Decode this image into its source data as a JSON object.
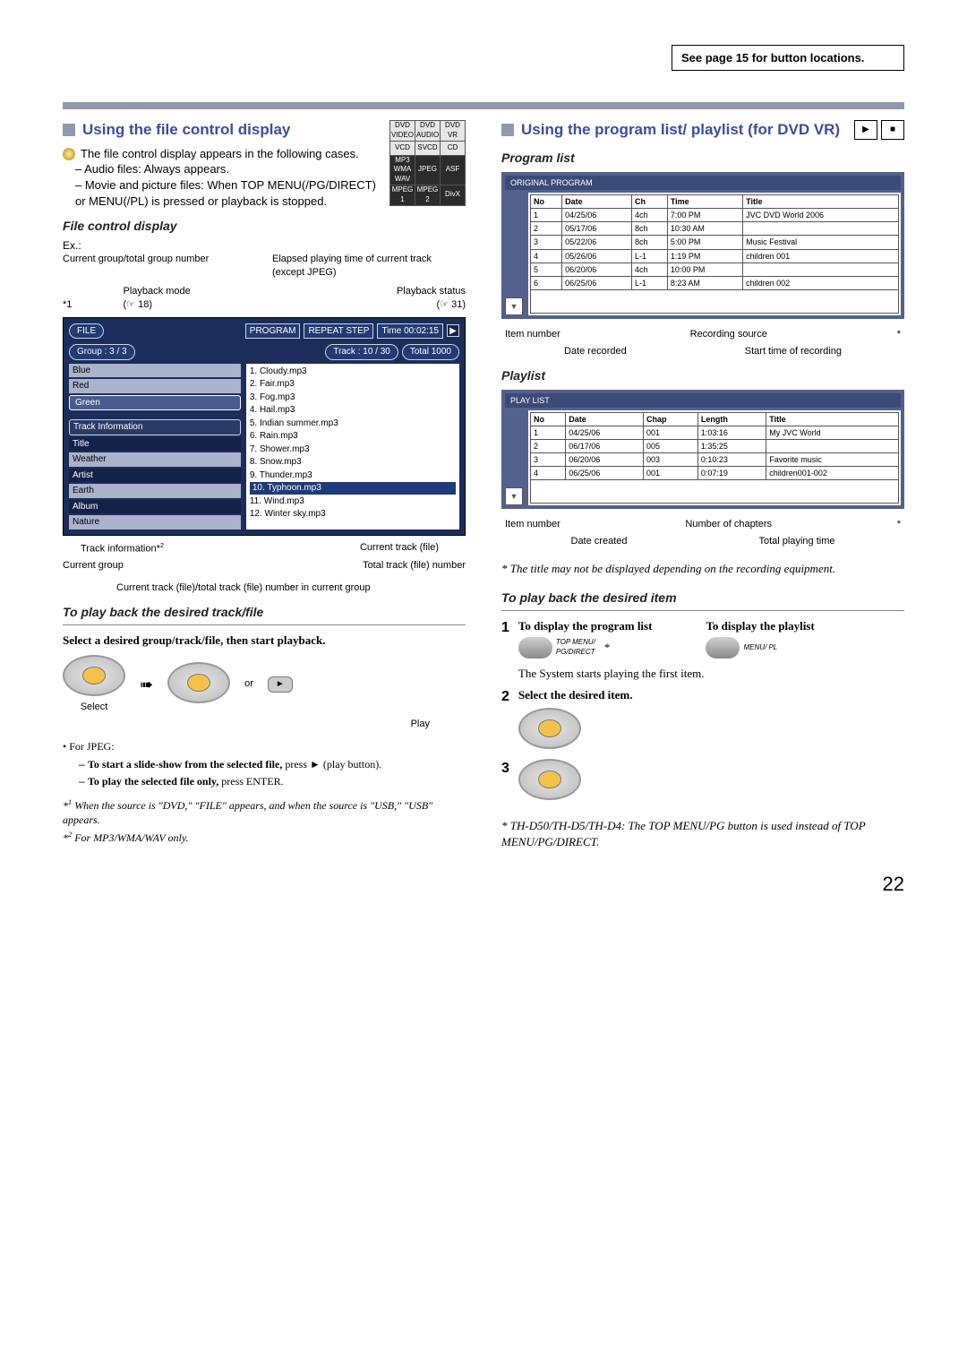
{
  "top_note": "See page 15 for button locations.",
  "left": {
    "heading": "Using the file control display",
    "intro": "The file control display appears in the following cases.",
    "bullets": [
      "Audio files: Always appears.",
      "Movie and picture files: When TOP MENU(/PG/DIRECT) or MENU(/PL) is pressed or playback is stopped."
    ],
    "format_cells": [
      [
        "DVD VIDEO",
        "DVD AUDIO",
        "DVD VR"
      ],
      [
        "VCD",
        "SVCD",
        "CD"
      ],
      [
        "MP3 WMA WAV",
        "JPEG",
        "ASF"
      ],
      [
        "MPEG 1",
        "MPEG 2",
        "DivX"
      ]
    ],
    "file_control_heading": "File control display",
    "ex": "Ex.:",
    "annot_top_left": "Current group/total group number",
    "annot_top_right": "Elapsed playing time of current track (except JPEG)",
    "annot_mid_left": "Playback mode",
    "annot_mid_left_ref": "(☞ 18)",
    "annot_mid_right": "Playback status",
    "annot_mid_right_ref": "(☞ 31)",
    "star1": "*1",
    "fd": {
      "file_label": "FILE",
      "program": "PROGRAM",
      "repeat": "REPEAT STEP",
      "time": "Time 00:02:15",
      "group": "Group :   3 / 3",
      "track": "Track : 10 / 30",
      "total": "Total 1000",
      "left_items": [
        "Blue",
        "Red",
        "Green"
      ],
      "track_info_hdr": "Track  Information",
      "track_info": [
        "Title",
        "Weather",
        "Artist",
        "Earth",
        "Album",
        "Nature"
      ],
      "right_items": [
        "1. Cloudy.mp3",
        "2. Fair.mp3",
        "3. Fog.mp3",
        "4. Hail.mp3",
        "5. Indian summer.mp3",
        "6. Rain.mp3",
        "7. Shower.mp3",
        "8. Snow.mp3",
        "9. Thunder.mp3",
        "10. Typhoon.mp3",
        "11. Wind.mp3",
        "12. Winter sky.mp3"
      ],
      "sel_index": 9
    },
    "annot_track_info": "Track information*2",
    "annot_current_track": "Current track (file)",
    "annot_current_group": "Current group",
    "annot_total_track": "Total track (file) number",
    "annot_ratio": "Current track (file)/total track (file) number in current group",
    "play_heading": "To play back the desired track/file",
    "play_instruction": "Select a desired group/track/file, then start playback.",
    "select_label": "Select",
    "or": "or",
    "play_label": "Play",
    "jpeg_hdr": "For JPEG:",
    "jpeg_a_bold": "To start a slide-show from the selected file,",
    "jpeg_a_rest": " press ► (play button).",
    "jpeg_b_bold": "To play the selected file only,",
    "jpeg_b_rest": " press ENTER.",
    "fn1": "*1 When the source is \"DVD,\" \"FILE\" appears, and when the source is \"USB,\" \"USB\" appears.",
    "fn2": "*2 For MP3/WMA/WAV only."
  },
  "right": {
    "heading": "Using the program list/ playlist (for DVD VR)",
    "program_list_heading": "Program list",
    "program_table": {
      "title": "ORIGINAL PROGRAM",
      "headers": [
        "No",
        "Date",
        "Ch",
        "Time",
        "Title"
      ],
      "rows": [
        [
          "1",
          "04/25/06",
          "4ch",
          "7:00 PM",
          "JVC DVD World 2006"
        ],
        [
          "2",
          "05/17/06",
          "8ch",
          "10:30 AM",
          ""
        ],
        [
          "3",
          "05/22/06",
          "8ch",
          "5:00 PM",
          "Music Festival"
        ],
        [
          "4",
          "05/26/06",
          "L-1",
          "1:19 PM",
          "children 001"
        ],
        [
          "5",
          "06/20/06",
          "4ch",
          "10:00 PM",
          ""
        ],
        [
          "6",
          "06/25/06",
          "L-1",
          "8:23 AM",
          "children 002"
        ]
      ]
    },
    "prog_callouts_top": [
      "Item number",
      "Recording source",
      "*"
    ],
    "prog_callouts_bot": [
      "Date recorded",
      "Start time of recording"
    ],
    "playlist_heading": "Playlist",
    "playlist_table": {
      "title": "PLAY LIST",
      "headers": [
        "No",
        "Date",
        "Chap",
        "Length",
        "Title"
      ],
      "rows": [
        [
          "1",
          "04/25/06",
          "001",
          "1:03:16",
          "My JVC World"
        ],
        [
          "2",
          "06/17/06",
          "005",
          "1:35:25",
          ""
        ],
        [
          "3",
          "06/20/06",
          "003",
          "0:10:23",
          "Favorite music"
        ],
        [
          "4",
          "06/25/06",
          "001",
          "0:07:19",
          "children001-002"
        ]
      ]
    },
    "play_callouts_top": [
      "Item number",
      "Number of chapters",
      "*"
    ],
    "play_callouts_bot": [
      "Date created",
      "Total playing time"
    ],
    "title_note": "*  The title may not be displayed depending on the recording equipment.",
    "play_item_heading": "To play back the desired item",
    "step1_left": "To display the program list",
    "step1_right": "To display the playlist",
    "btn_top": "TOP MENU/ PG/DIRECT",
    "btn_menu": "MENU/ PL",
    "step1_after": "The System starts playing the first item.",
    "step2": "Select the desired item.",
    "bottom_note": "*  TH-D50/TH-D5/TH-D4: The TOP MENU/PG button is used instead of TOP MENU/PG/DIRECT.",
    "asterisk": "*"
  },
  "page_number": "22"
}
